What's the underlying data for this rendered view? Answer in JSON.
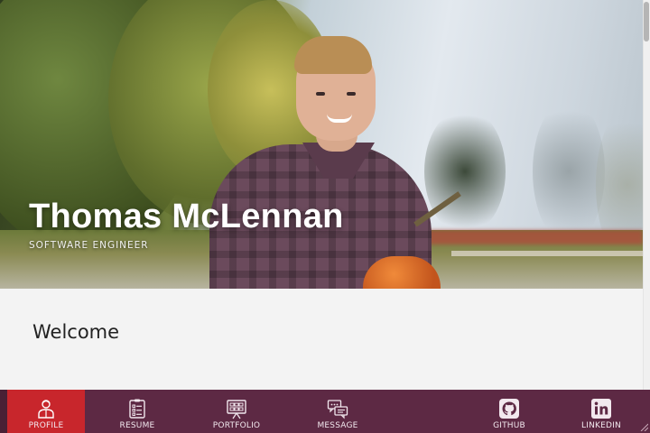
{
  "hero": {
    "name": "Thomas McLennan",
    "role": "SOFTWARE ENGINEER"
  },
  "main": {
    "heading": "Welcome"
  },
  "nav": {
    "items": [
      {
        "label": "PROFILE",
        "icon": "person-icon",
        "active": true
      },
      {
        "label": "RESUME",
        "icon": "clipboard-icon",
        "active": false
      },
      {
        "label": "PORTFOLIO",
        "icon": "presentation-board-icon",
        "active": false
      },
      {
        "label": "MESSAGE",
        "icon": "chat-bubbles-icon",
        "active": false
      },
      {
        "label": "GITHUB",
        "icon": "github-icon",
        "active": false
      },
      {
        "label": "LINKEDIN",
        "icon": "linkedin-icon",
        "active": false
      }
    ]
  },
  "colors": {
    "nav_background": "#5d2944",
    "nav_active": "#c8262c",
    "page_background": "#f3f3f3",
    "hero_text": "#ffffff"
  }
}
